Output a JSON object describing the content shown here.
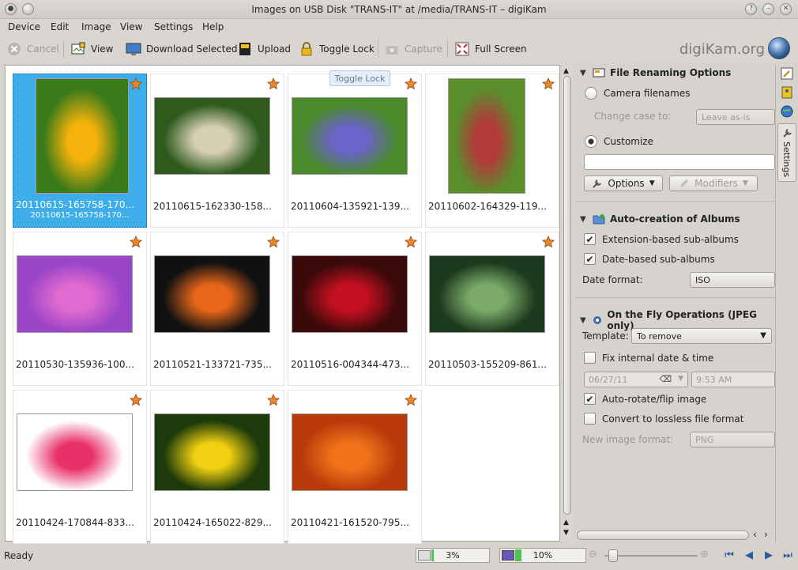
{
  "window": {
    "title": "Images on USB Disk \"TRANS-IT\" at /media/TRANS-IT – digiKam"
  },
  "menu": [
    "Device",
    "Edit",
    "Image",
    "View",
    "Settings",
    "Help"
  ],
  "toolbar": {
    "cancel": "Cancel",
    "view": "View",
    "download_selected": "Download Selected",
    "upload": "Upload",
    "toggle_lock": "Toggle Lock",
    "capture": "Capture",
    "full_screen": "Full Screen",
    "brand": "digiKam.org"
  },
  "tooltip": "Toggle Lock",
  "thumbnails": [
    {
      "caption": "20110615-165758-170...",
      "subcaption": "20110615-165758-170...",
      "colors": [
        "#3a7a1a",
        "#f4b20a"
      ]
    },
    {
      "caption": "20110615-162330-158...",
      "colors": [
        "#2e5a1e",
        "#d6d0b5"
      ]
    },
    {
      "caption": "20110604-135921-139...",
      "colors": [
        "#4b8a2a",
        "#6a64c8"
      ]
    },
    {
      "caption": "20110602-164329-119...",
      "colors": [
        "#5a8e2c",
        "#b23a3a"
      ]
    },
    {
      "caption": "20110530-135936-100...",
      "colors": [
        "#9a44c8",
        "#e06ad0"
      ]
    },
    {
      "caption": "20110521-133721-735...",
      "colors": [
        "#111111",
        "#e8661a"
      ]
    },
    {
      "caption": "20110516-004344-473...",
      "colors": [
        "#3a0a0a",
        "#c41020"
      ]
    },
    {
      "caption": "20110503-155209-861...",
      "colors": [
        "#1e3a1e",
        "#7aab6a"
      ]
    },
    {
      "caption": "20110424-170844-833...",
      "colors": [
        "#ffffff",
        "#e8306a"
      ]
    },
    {
      "caption": "20110424-165022-829...",
      "colors": [
        "#1c3a0a",
        "#f0d010"
      ]
    },
    {
      "caption": "20110421-161520-795...",
      "colors": [
        "#b83a0a",
        "#f0721a"
      ]
    }
  ],
  "panel": {
    "renaming": {
      "header": "File Renaming Options",
      "camera_filenames": "Camera filenames",
      "change_case_label": "Change case to:",
      "change_case_value": "Leave as-is",
      "customize": "Customize",
      "customize_value": "",
      "options": "Options",
      "modifiers": "Modifiers"
    },
    "albums": {
      "header": "Auto-creation of Albums",
      "extension": "Extension-based sub-albums",
      "date_based": "Date-based sub-albums",
      "date_format_label": "Date format:",
      "date_format_value": "ISO"
    },
    "fly": {
      "header": "On the Fly Operations (JPEG only)",
      "template_label": "Template:",
      "template_value": "To remove",
      "fix_date": "Fix internal date & time",
      "date_value": "06/27/11",
      "time_value": "9:53 AM",
      "autorotate": "Auto-rotate/flip image",
      "convert": "Convert to lossless file format",
      "new_format_label": "New image format:",
      "new_format_value": "PNG"
    }
  },
  "sidetab": {
    "settings": "Settings"
  },
  "status": {
    "text": "Ready",
    "progress1": "3%",
    "progress2": "10%"
  }
}
